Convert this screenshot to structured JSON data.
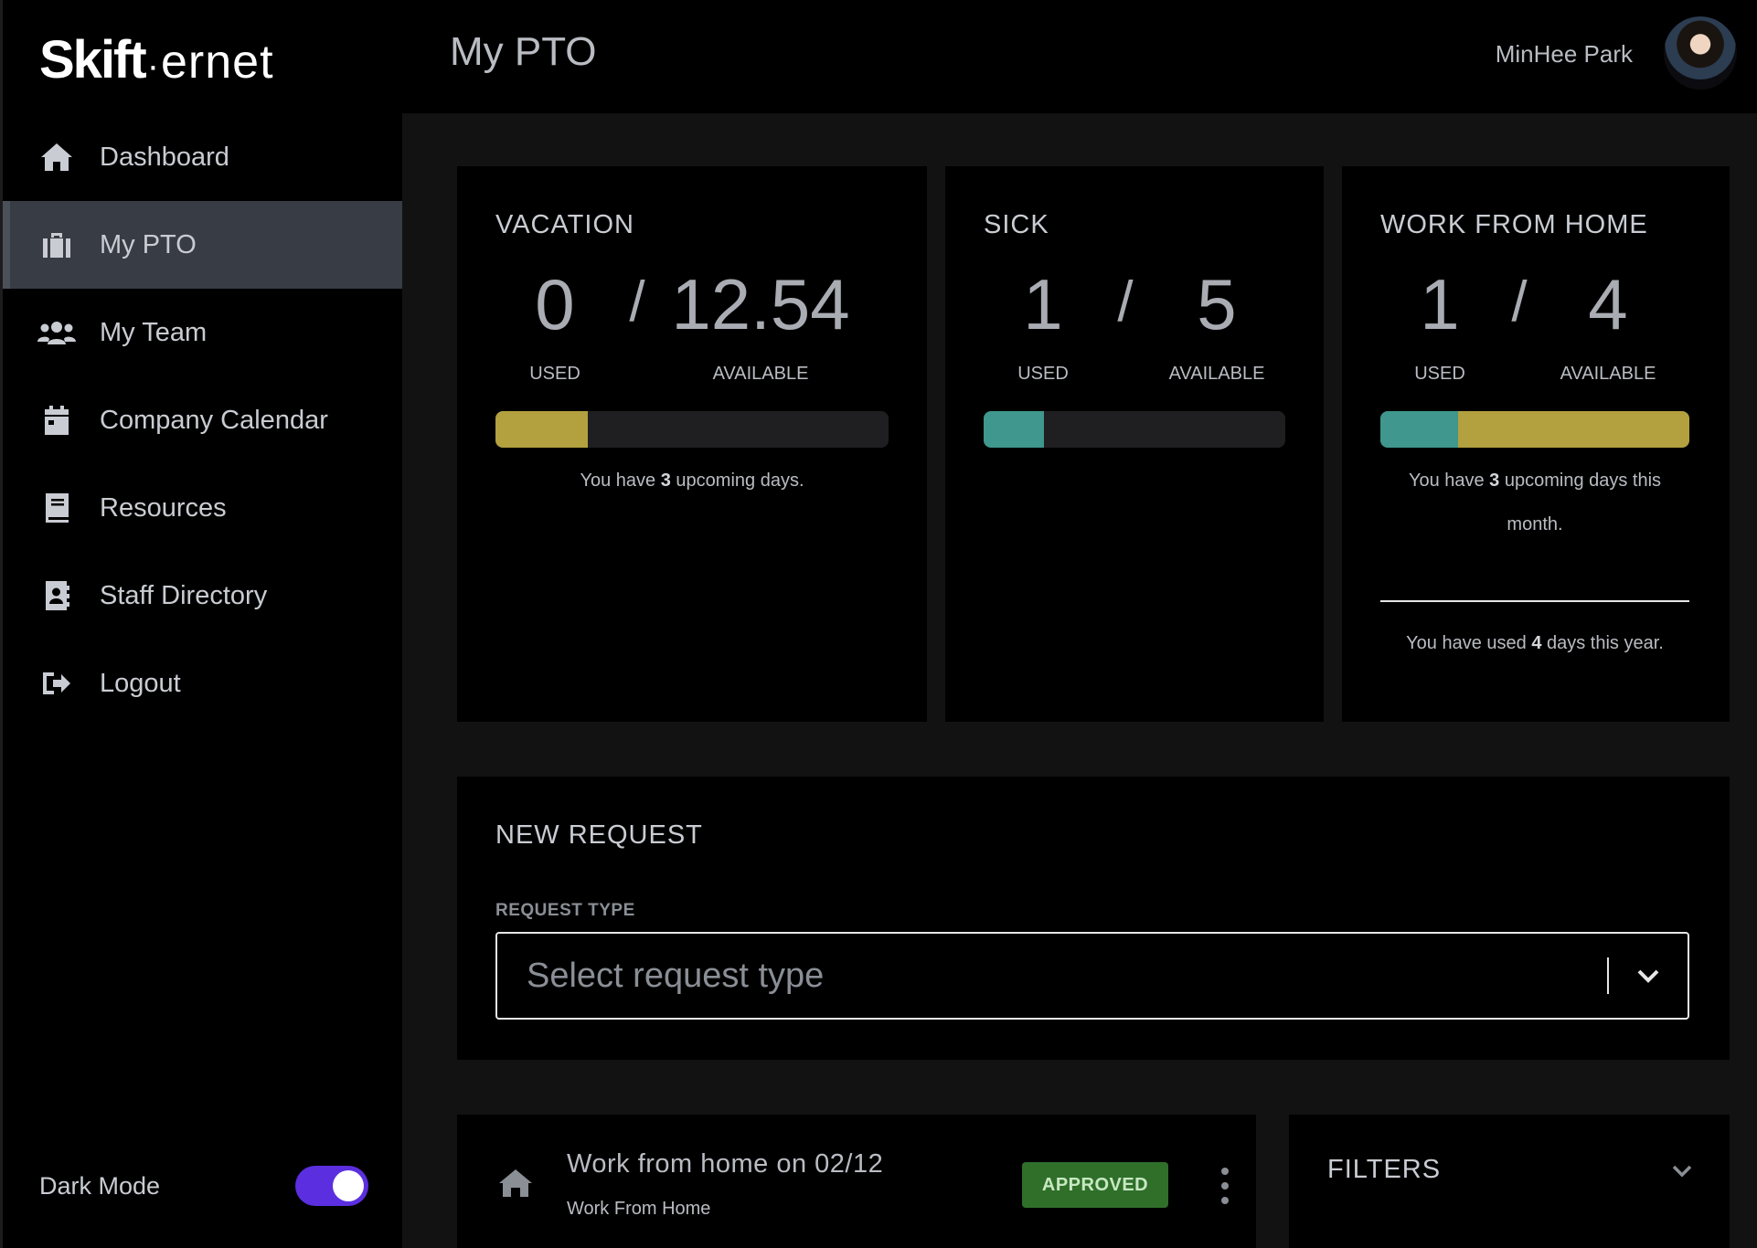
{
  "brand": {
    "logo_bold": "Skift",
    "logo_dot": "·",
    "logo_light": "ernet"
  },
  "sidebar": {
    "items": [
      {
        "label": "Dashboard",
        "icon": "home-icon"
      },
      {
        "label": "My PTO",
        "icon": "briefcase-icon",
        "active": true
      },
      {
        "label": "My Team",
        "icon": "users-icon"
      },
      {
        "label": "Company Calendar",
        "icon": "calendar-icon"
      },
      {
        "label": "Resources",
        "icon": "book-icon"
      },
      {
        "label": "Staff Directory",
        "icon": "address-book-icon"
      },
      {
        "label": "Logout",
        "icon": "sign-out-icon"
      }
    ],
    "dark_mode_label": "Dark Mode",
    "dark_mode_on": true
  },
  "header": {
    "title": "My PTO",
    "user_name": "MinHee Park"
  },
  "balances": {
    "vacation": {
      "title": "VACATION",
      "used": "0",
      "available": "12.54",
      "used_label": "USED",
      "available_label": "AVAILABLE",
      "note_pre": "You have ",
      "note_num": "3",
      "note_post": " upcoming days.",
      "bar_colors": [
        "#b3a03f"
      ],
      "bar_fractions": [
        0.236
      ]
    },
    "sick": {
      "title": "SICK",
      "used": "1",
      "available": "5",
      "used_label": "USED",
      "available_label": "AVAILABLE",
      "bar_colors": [
        "#3f978d"
      ],
      "bar_fractions": [
        0.2
      ]
    },
    "wfh": {
      "title": "WORK FROM HOME",
      "used": "1",
      "available": "4",
      "used_label": "USED",
      "available_label": "AVAILABLE",
      "note_pre": "You have ",
      "note_num": "3",
      "note_post": " upcoming days this month.",
      "note2_pre": "You have used ",
      "note2_num": "4",
      "note2_post": " days this year.",
      "bar_colors": [
        "#3f978d",
        "#b3a03f"
      ],
      "bar_fractions": [
        0.25,
        0.75
      ]
    }
  },
  "new_request": {
    "title": "NEW REQUEST",
    "type_label": "REQUEST TYPE",
    "placeholder": "Select request type"
  },
  "requests": [
    {
      "title": "Work from home on 02/12",
      "subtitle": "Work From Home",
      "status": "APPROVED",
      "icon": "home-icon"
    }
  ],
  "filters": {
    "title": "FILTERS"
  },
  "colors": {
    "accent": "#5b2fe0",
    "vacation": "#b3a03f",
    "sick": "#3f978d",
    "approved": "#2f6f2a"
  }
}
